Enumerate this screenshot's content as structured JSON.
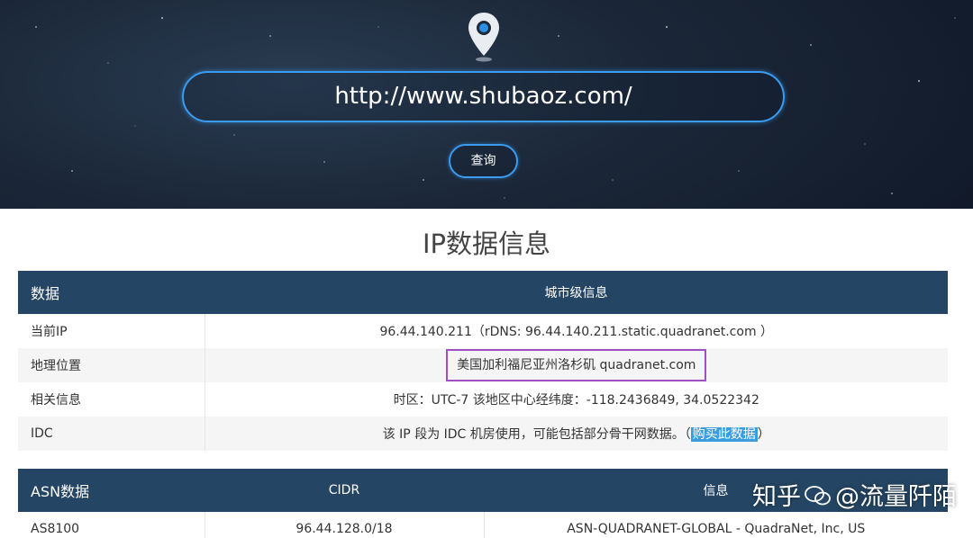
{
  "hero": {
    "url_value": "http://www.shubaoz.com/",
    "query_label": "查询"
  },
  "ip_section": {
    "title": "IP数据信息",
    "headers": [
      "数据",
      "城市级信息"
    ],
    "rows": [
      {
        "label": "当前IP",
        "value": "96.44.140.211（rDNS: 96.44.140.211.static.quadranet.com ）"
      },
      {
        "label": "地理位置",
        "value": "美国加利福尼亚州洛杉矶 quadranet.com"
      },
      {
        "label": "相关信息",
        "value": "时区：UTC-7 该地区中心经纬度：-118.2436849, 34.0522342"
      },
      {
        "label": "IDC",
        "value_prefix": "该 IP 段为 IDC 机房使用，可能包括部分骨干网数据。（",
        "link": "购买此数据",
        "value_suffix": "）"
      }
    ]
  },
  "asn_section": {
    "headers": [
      "ASN数据",
      "CIDR",
      "信息"
    ],
    "rows": [
      {
        "asn": "AS8100",
        "cidr": "96.44.128.0/18",
        "info": "ASN-QUADRANET-GLOBAL - QuadraNet, Inc, US"
      }
    ]
  },
  "watermark": {
    "left": "知乎",
    "right": "@流量阡陌"
  },
  "colors": {
    "header_bg": "#244664",
    "accent_blue": "#3a9bf0",
    "highlight_border": "#a24fc6"
  }
}
